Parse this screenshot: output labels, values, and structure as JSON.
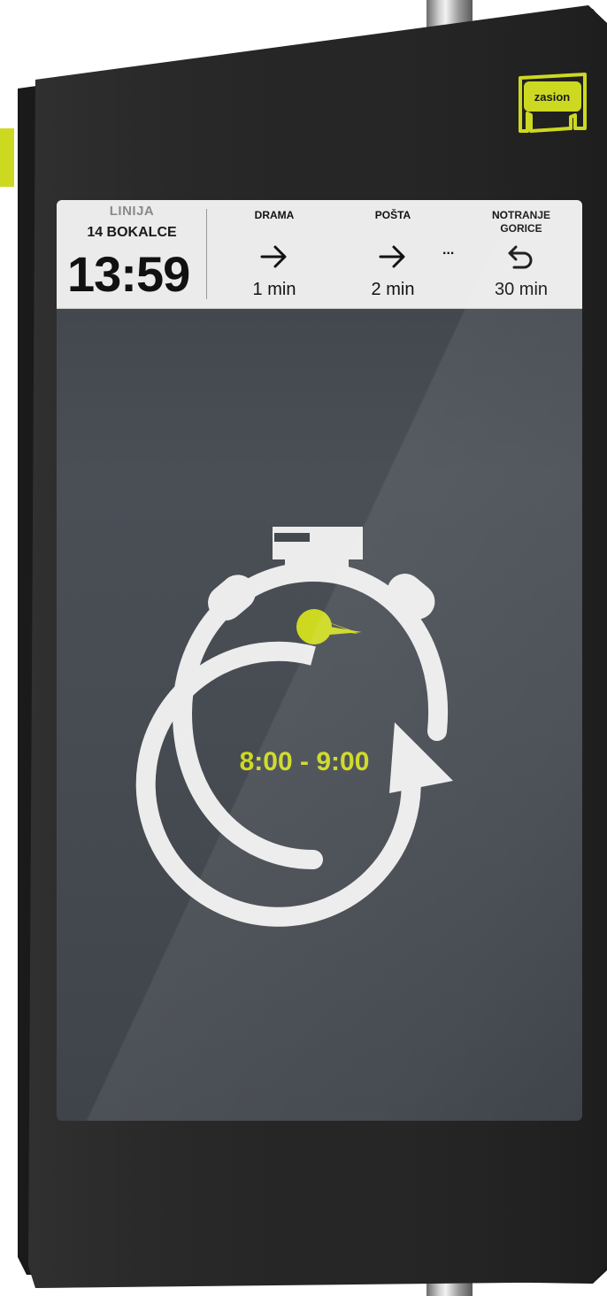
{
  "brand": {
    "logo_text": "zasion",
    "accent_color": "#cdd921"
  },
  "route": {
    "line_label": "LINIJA",
    "line_name": "14 BOKALCE",
    "current_time": "13:59"
  },
  "stops": [
    {
      "name": "DRAMA",
      "icon": "arrow-right-icon",
      "time": "1 min"
    },
    {
      "name": "POŠTA",
      "icon": "arrow-right-icon",
      "time": "2 min"
    },
    {
      "name": "NOTRANJE GORICE",
      "icon": "return-arrow-icon",
      "time": "30 min"
    }
  ],
  "more_indicator": "...",
  "timer": {
    "icon": "stopwatch-icon",
    "range": "8:00 - 9:00"
  }
}
